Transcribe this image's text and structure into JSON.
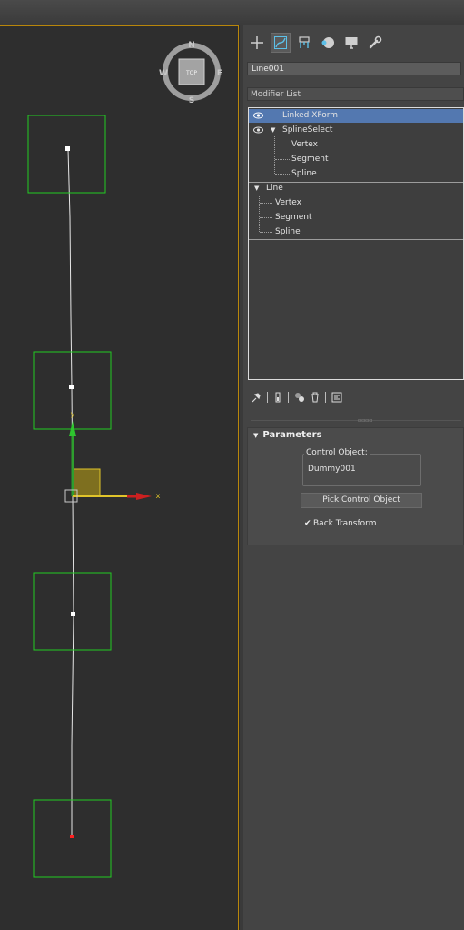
{
  "viewcube": {
    "north": "N",
    "south": "S",
    "east": "E",
    "west": "W",
    "face": "TOP"
  },
  "gizmo": {
    "x_label": "x",
    "y_label": "y"
  },
  "command_panel": {
    "tabs": [
      {
        "name": "create-tab",
        "icon": "plus-icon"
      },
      {
        "name": "modify-tab",
        "icon": "modify-curve-icon",
        "active": true
      },
      {
        "name": "hierarchy-tab",
        "icon": "hierarchy-icon"
      },
      {
        "name": "motion-tab",
        "icon": "motion-sphere-icon"
      },
      {
        "name": "display-tab",
        "icon": "display-monitor-icon"
      },
      {
        "name": "utilities-tab",
        "icon": "wrench-icon"
      }
    ],
    "object_name": "Line001",
    "modifier_list": "Modifier List",
    "stack": {
      "linked_xform": "Linked XForm",
      "spline_select": "SplineSelect",
      "spline_select_sub": [
        "Vertex",
        "Segment",
        "Spline"
      ],
      "line": "Line",
      "line_sub": [
        "Vertex",
        "Segment",
        "Spline"
      ]
    },
    "parameters": {
      "title": "Parameters",
      "control_object_label": "Control Object:",
      "control_object_value": "Dummy001",
      "pick_button": "Pick Control Object",
      "back_transform": "Back Transform",
      "back_transform_checked": true
    }
  },
  "colors": {
    "selection_box": "#22cc22",
    "selected_row": "#5378b0",
    "viewport_border": "#b8860b"
  }
}
